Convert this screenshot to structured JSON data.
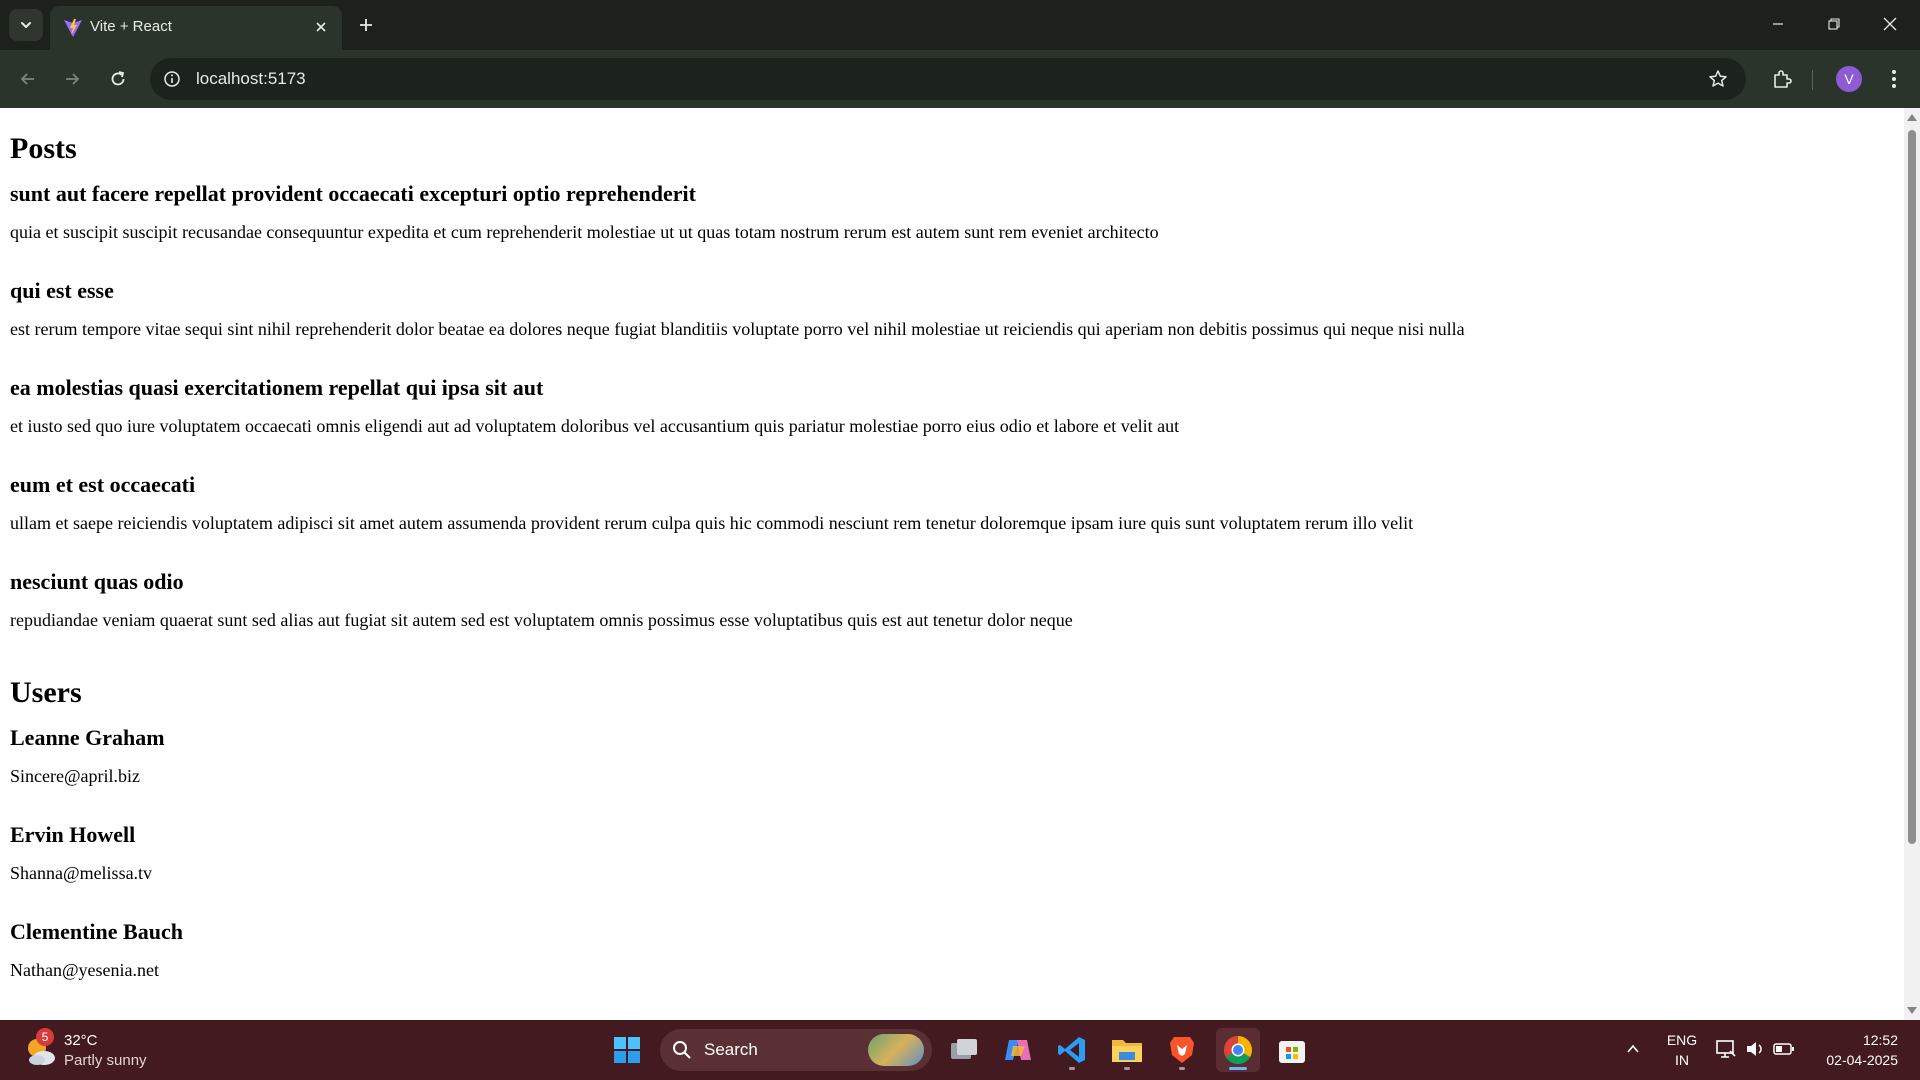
{
  "browser": {
    "tab_title": "Vite + React",
    "url": "localhost:5173",
    "profile_initial": "V"
  },
  "page": {
    "posts_heading": "Posts",
    "posts": [
      {
        "title": "sunt aut facere repellat provident occaecati excepturi optio reprehenderit",
        "body": "quia et suscipit suscipit recusandae consequuntur expedita et cum reprehenderit molestiae ut ut quas totam nostrum rerum est autem sunt rem eveniet architecto"
      },
      {
        "title": "qui est esse",
        "body": "est rerum tempore vitae sequi sint nihil reprehenderit dolor beatae ea dolores neque fugiat blanditiis voluptate porro vel nihil molestiae ut reiciendis qui aperiam non debitis possimus qui neque nisi nulla"
      },
      {
        "title": "ea molestias quasi exercitationem repellat qui ipsa sit aut",
        "body": "et iusto sed quo iure voluptatem occaecati omnis eligendi aut ad voluptatem doloribus vel accusantium quis pariatur molestiae porro eius odio et labore et velit aut"
      },
      {
        "title": "eum et est occaecati",
        "body": "ullam et saepe reiciendis voluptatem adipisci sit amet autem assumenda provident rerum culpa quis hic commodi nesciunt rem tenetur doloremque ipsam iure quis sunt voluptatem rerum illo velit"
      },
      {
        "title": "nesciunt quas odio",
        "body": "repudiandae veniam quaerat sunt sed alias aut fugiat sit autem sed est voluptatem omnis possimus esse voluptatibus quis est aut tenetur dolor neque"
      }
    ],
    "users_heading": "Users",
    "users": [
      {
        "name": "Leanne Graham",
        "email": "Sincere@april.biz"
      },
      {
        "name": "Ervin Howell",
        "email": "Shanna@melissa.tv"
      },
      {
        "name": "Clementine Bauch",
        "email": "Nathan@yesenia.net"
      }
    ]
  },
  "taskbar": {
    "weather_badge": "5",
    "weather_temp": "32°C",
    "weather_desc": "Partly sunny",
    "search_label": "Search",
    "lang_line1": "ENG",
    "lang_line2": "IN",
    "time": "12:52",
    "date": "02-04-2025",
    "apps": [
      "start-icon",
      "task-view-icon",
      "copilot-icon",
      "vscode-icon",
      "file-explorer-icon",
      "brave-icon",
      "chrome-icon",
      "store-icon"
    ]
  },
  "colors": {
    "chrome_dark": "#1c211c",
    "chrome_toolbar": "#2a342a",
    "taskbar": "#431a1f",
    "profile": "#8e5bd6"
  }
}
